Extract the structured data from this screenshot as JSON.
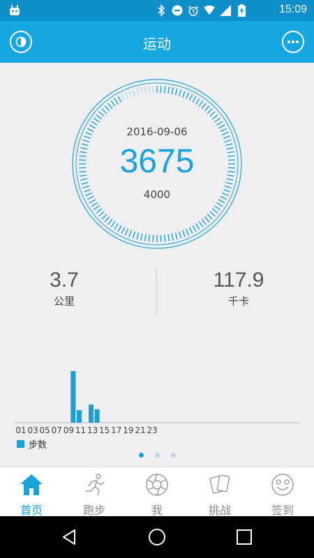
{
  "status": {
    "time": "15:09"
  },
  "header": {
    "title": "运动"
  },
  "ring": {
    "date": "2016-09-06",
    "steps": "3675",
    "goal": "4000"
  },
  "stats": {
    "distance": {
      "value": "3.7",
      "unit": "公里"
    },
    "calories": {
      "value": "117.9",
      "unit": "千卡"
    }
  },
  "colors": {
    "accent": "#1aa3d9",
    "appbar": "#17a7e0",
    "statusbar": "#0f8fc9",
    "bar": "#1a9fd4"
  },
  "chart_data": {
    "type": "bar",
    "x_ticks": [
      "01",
      "03",
      "05",
      "07",
      "09",
      "11",
      "13",
      "15",
      "17",
      "19",
      "21",
      "23"
    ],
    "hours": [
      9,
      10,
      12,
      13
    ],
    "values": [
      1850,
      450,
      650,
      480
    ],
    "ylim": [
      0,
      2000
    ],
    "legend": "步数",
    "legend_position": "bottom-left",
    "grid": false
  },
  "pager": {
    "count": 3,
    "active": 0
  },
  "tabs": [
    {
      "label": "首页",
      "icon": "home-icon",
      "active": true
    },
    {
      "label": "跑步",
      "icon": "runner-icon",
      "active": false
    },
    {
      "label": "我",
      "icon": "aperture-icon",
      "active": false
    },
    {
      "label": "挑战",
      "icon": "cards-icon",
      "active": false
    },
    {
      "label": "签到",
      "icon": "smiley-icon",
      "active": false
    }
  ]
}
